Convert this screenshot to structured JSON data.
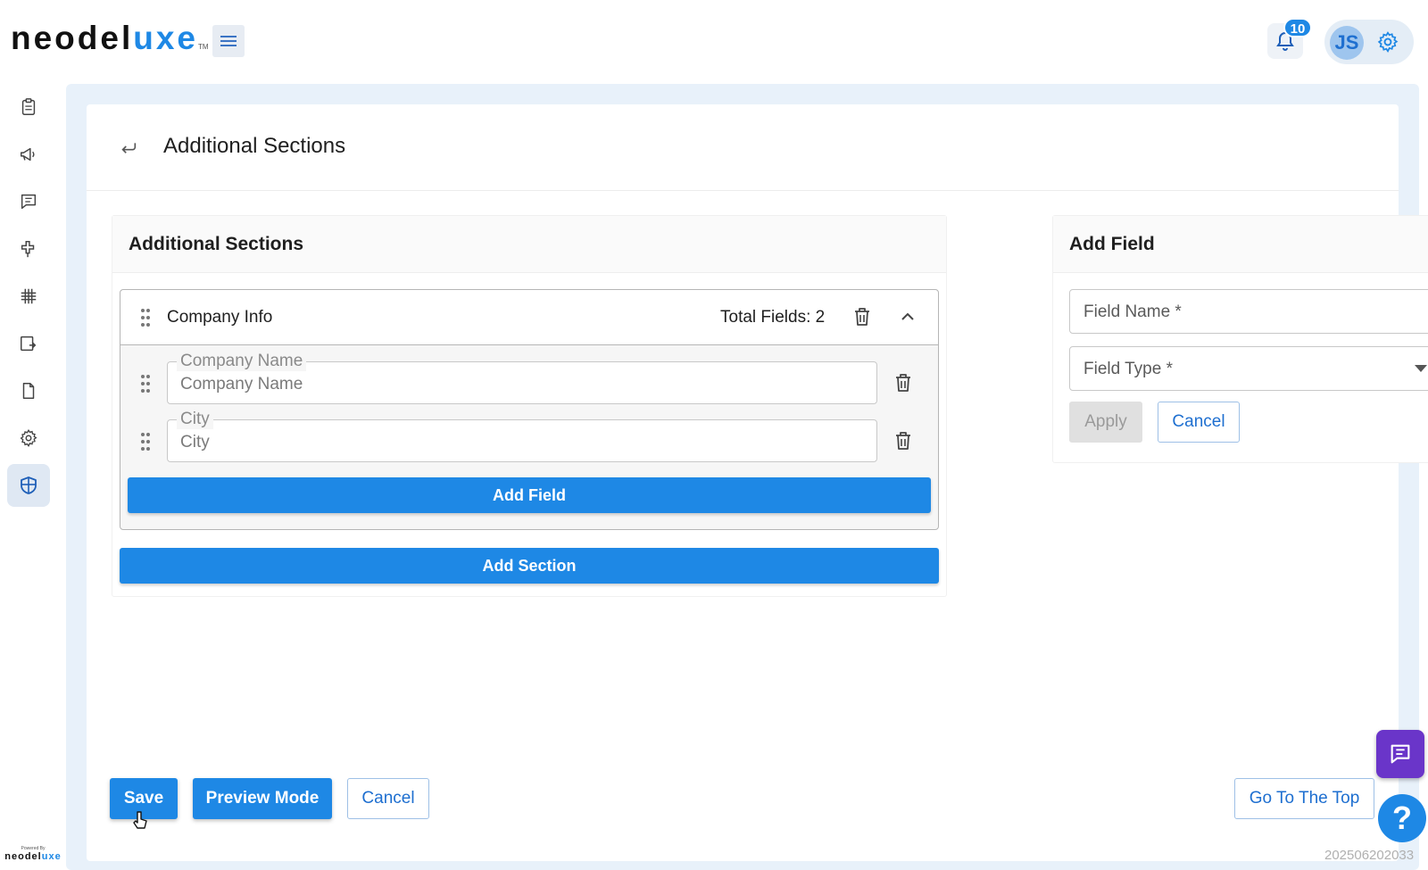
{
  "app": {
    "logo_main": "neodel",
    "logo_highlight": "uxe",
    "logo_tm": "TM",
    "notifications_count": "10",
    "user_initials": "JS",
    "powered_by": "Powered By",
    "powered_logo_main": "neodel",
    "powered_logo_highlight": "uxe",
    "build_id": "202506202033",
    "accent_color": "#1e88e5"
  },
  "sidebar": {
    "items": [
      {
        "icon": "clipboard-icon"
      },
      {
        "icon": "megaphone-icon"
      },
      {
        "icon": "message-icon"
      },
      {
        "icon": "connector-icon"
      },
      {
        "icon": "grid-icon"
      },
      {
        "icon": "form-share-icon"
      },
      {
        "icon": "document-icon"
      },
      {
        "icon": "gear-icon"
      },
      {
        "icon": "shield-icon",
        "active": true
      }
    ]
  },
  "header": {
    "title": "Additional Sections"
  },
  "left_panel": {
    "title": "Additional Sections",
    "section": {
      "name": "Company Info",
      "total_fields": "Total Fields: 2",
      "fields": [
        {
          "legend": "Company Name",
          "value": "Company Name"
        },
        {
          "legend": "City",
          "value": "City"
        }
      ],
      "add_field_label": "Add Field"
    },
    "add_section_label": "Add Section"
  },
  "right_panel": {
    "title": "Add Field",
    "field_name_placeholder": "Field Name *",
    "field_type_placeholder": "Field Type *",
    "apply_label": "Apply",
    "cancel_label": "Cancel"
  },
  "footer": {
    "save_label": "Save",
    "preview_label": "Preview Mode",
    "cancel_label": "Cancel",
    "top_label": "Go To The Top"
  },
  "help_label": "?"
}
